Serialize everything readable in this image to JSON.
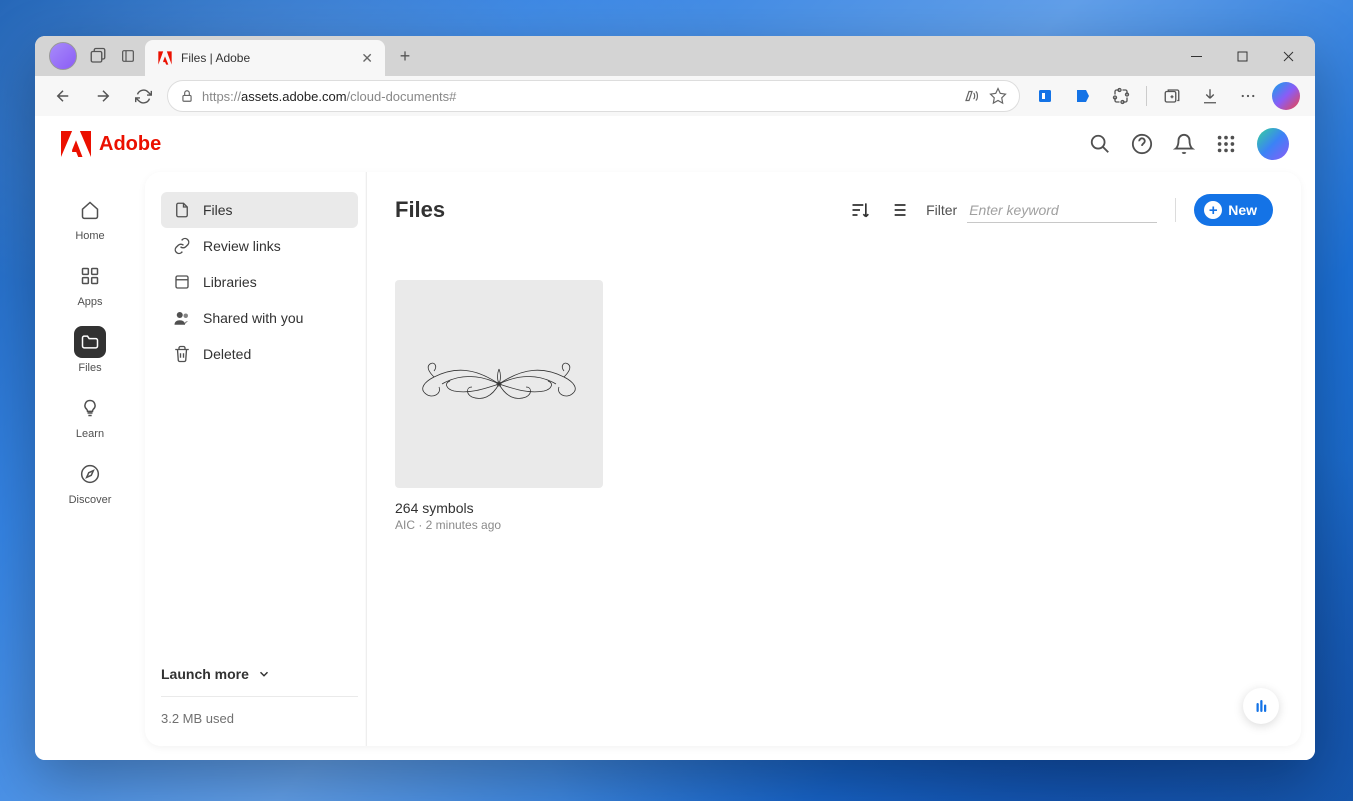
{
  "browser": {
    "tab_title": "Files | Adobe",
    "url_proto": "https://",
    "url_host": "assets.adobe.com",
    "url_path": "/cloud-documents#"
  },
  "adobe": {
    "brand": "Adobe"
  },
  "rail": {
    "items": [
      {
        "label": "Home"
      },
      {
        "label": "Apps"
      },
      {
        "label": "Files"
      },
      {
        "label": "Learn"
      },
      {
        "label": "Discover"
      }
    ]
  },
  "sidebar": {
    "items": [
      {
        "label": "Files"
      },
      {
        "label": "Review links"
      },
      {
        "label": "Libraries"
      },
      {
        "label": "Shared with you"
      },
      {
        "label": "Deleted"
      }
    ],
    "launch_more": "Launch more",
    "storage": "3.2 MB used"
  },
  "panel": {
    "title": "Files",
    "filter_label": "Filter",
    "filter_placeholder": "Enter keyword",
    "new_button": "New"
  },
  "files": [
    {
      "name": "264 symbols",
      "meta": "AIC · 2 minutes ago"
    }
  ]
}
